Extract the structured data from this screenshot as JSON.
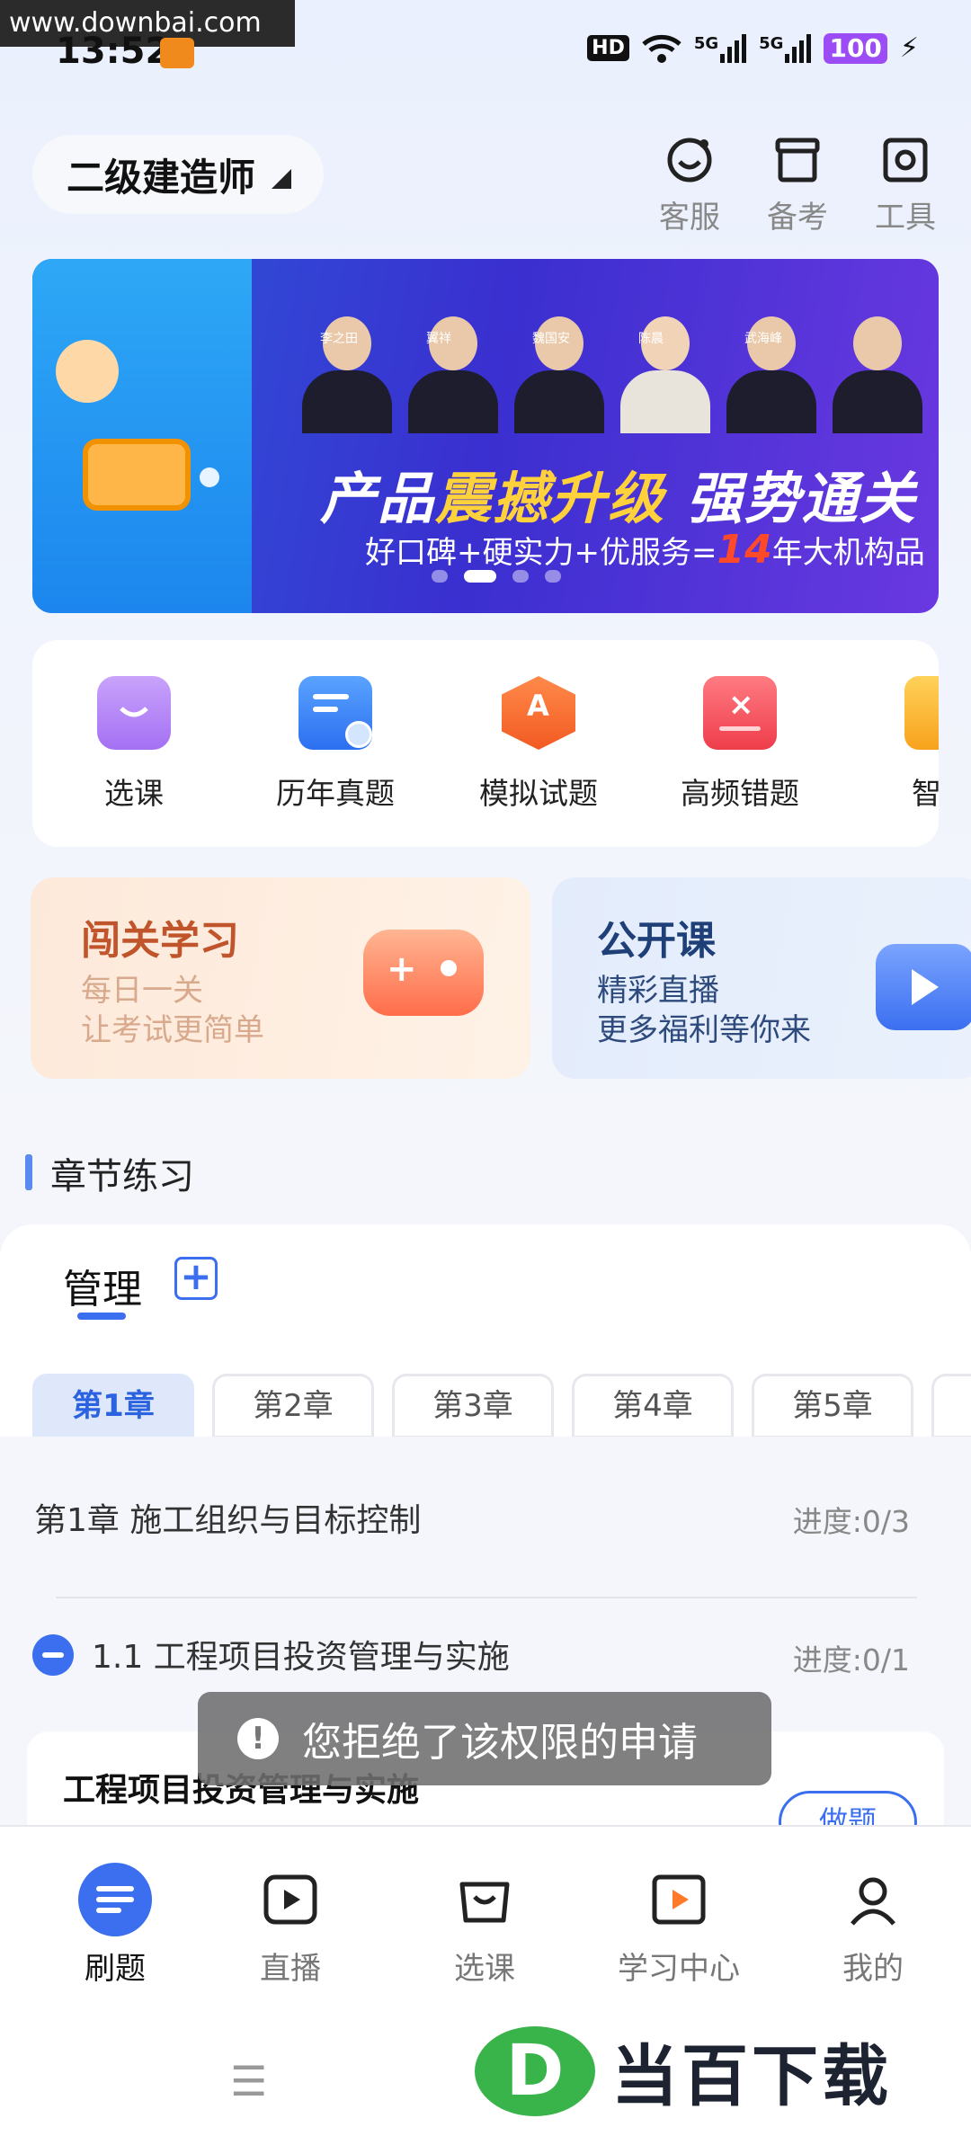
{
  "status_bar": {
    "watermark": "www.downbai.com",
    "time": "13:52",
    "hd": "HD",
    "net1": "5G",
    "net2": "5G",
    "battery": "100"
  },
  "header": {
    "exam_selector": "二级建造师",
    "buttons": [
      {
        "label": "客服",
        "icon": "customer-service-icon"
      },
      {
        "label": "备考",
        "icon": "prep-box-icon"
      },
      {
        "label": "工具",
        "icon": "tools-icon"
      }
    ]
  },
  "banner": {
    "teachers": [
      "李之田",
      "翼祥",
      "魏国安",
      "陈晨",
      "武海峰"
    ],
    "title_a": "产品",
    "title_b": "震撼升级",
    "title_c": " 强势通关",
    "subtitle_a": "好口碑+硬实力+优服务=",
    "subtitle_num": "14",
    "subtitle_b": "年大机构品",
    "slide_count": 4,
    "active_slide": 2
  },
  "quick_menu": [
    {
      "label": "选课",
      "icon": "shopping-bag-icon",
      "color": "#b07ef5"
    },
    {
      "label": "历年真题",
      "icon": "past-papers-icon",
      "color": "#3a86f5"
    },
    {
      "label": "模拟试题",
      "icon": "mock-test-icon",
      "color": "#ff6a3a"
    },
    {
      "label": "高频错题",
      "icon": "wrong-questions-icon",
      "color": "#f24a58"
    },
    {
      "label": "智能",
      "icon": "smart-icon",
      "color": "#f8b22c"
    }
  ],
  "promo": {
    "card1": {
      "title": "闯关学习",
      "line1": "每日一关",
      "line2": "让考试更简单"
    },
    "card2": {
      "title": "公开课",
      "line1": "精彩直播",
      "line2": "更多福利等你来"
    }
  },
  "chapter": {
    "section_title": "章节练习",
    "tab": "管理",
    "add": "+",
    "chapters": [
      "第1章",
      "第2章",
      "第3章",
      "第4章",
      "第5章"
    ],
    "active": "第1章",
    "row_title": "第1章 施工组织与目标控制",
    "row_progress": "进度:0/3",
    "sub_title": "1.1 工程项目投资管理与实施",
    "sub_progress": "进度:0/1",
    "card_title": "工程项目投资管理与实施",
    "do_button": "做题"
  },
  "toast": "您拒绝了该权限的申请",
  "bottom_nav": [
    {
      "label": "刷题",
      "icon": "practice-icon",
      "active": true
    },
    {
      "label": "直播",
      "icon": "live-icon",
      "active": false
    },
    {
      "label": "选课",
      "icon": "courses-icon",
      "active": false
    },
    {
      "label": "学习中心",
      "icon": "study-center-icon",
      "active": false
    },
    {
      "label": "我的",
      "icon": "profile-icon",
      "active": false
    }
  ],
  "footer_watermark": "当百下载",
  "colors": {
    "accent": "#3b6ff0",
    "card1_title": "#c0552c",
    "card2_title": "#1f3f78"
  }
}
